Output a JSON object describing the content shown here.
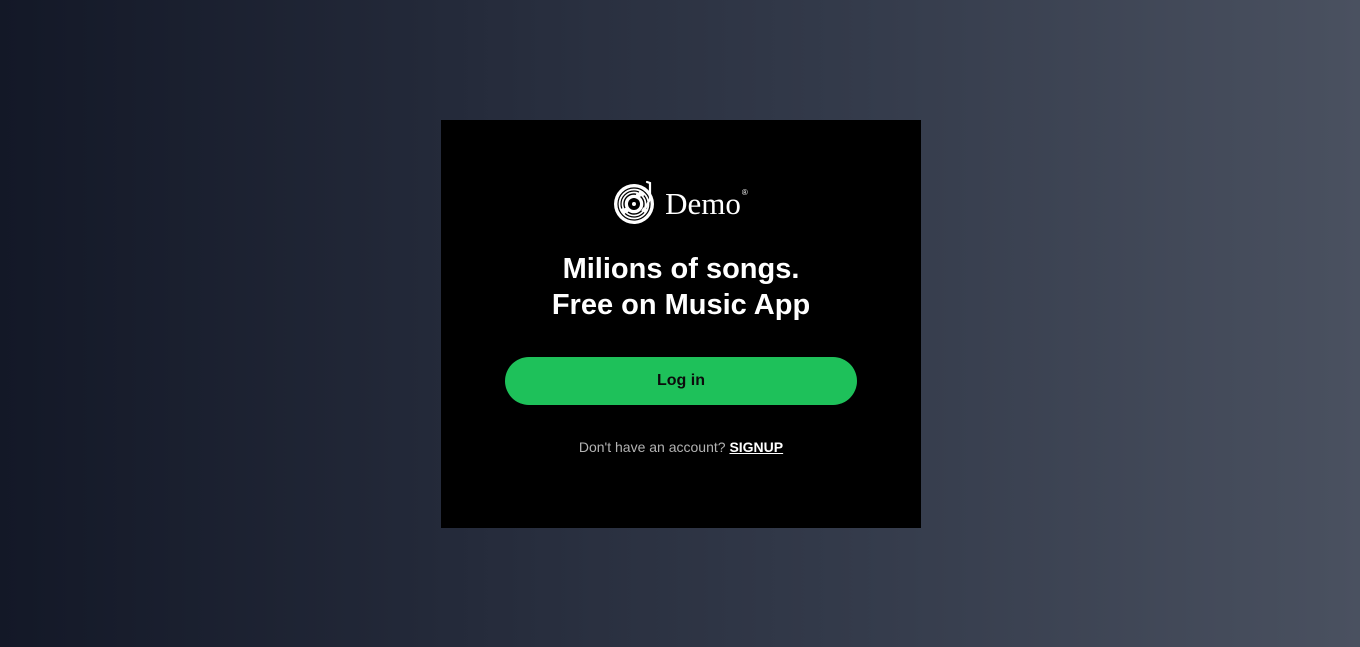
{
  "brand": {
    "logo_icon": "vinyl-record-icon",
    "name": "Demo",
    "registered_mark": "®"
  },
  "headline": {
    "line1": "Milions of songs.",
    "line2": "Free on Music App"
  },
  "login": {
    "label": "Log in",
    "color": "#1ec15a"
  },
  "signup": {
    "prompt": "Don't have an account?",
    "link_label": "SIGNUP"
  },
  "colors": {
    "card_background": "#000000",
    "page_gradient_start": "#131827",
    "page_gradient_end": "#4a5160"
  }
}
